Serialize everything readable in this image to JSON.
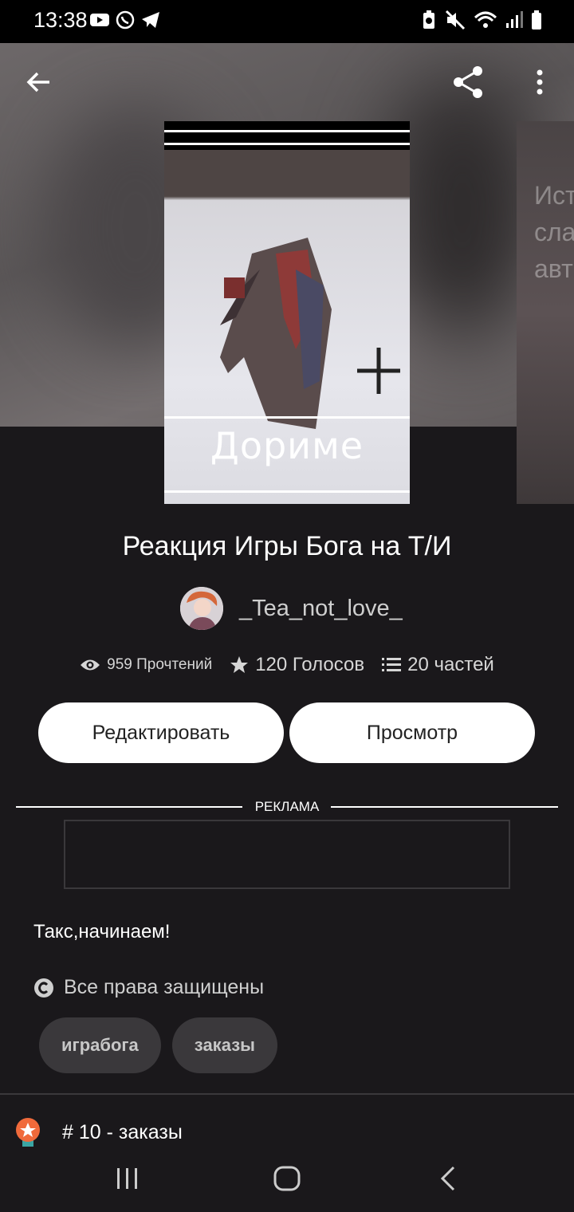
{
  "status_bar": {
    "time": "13:38"
  },
  "cover": {
    "title": "Дориме"
  },
  "next_cover": {
    "text": "Ист\nсла\nавт"
  },
  "story": {
    "title": "Реакция Игры Бога на Т/И",
    "author": "_Tea_not_love_"
  },
  "stats": {
    "reads": "959 Прочтений",
    "votes": "120 Голосов",
    "parts": "20 частей"
  },
  "actions": {
    "edit_label": "Редактировать",
    "view_label": "Просмотр"
  },
  "ad": {
    "label": "РЕКЛАМА"
  },
  "description": "Такс,начинаем!",
  "copyright": "Все права защищены",
  "tags": [
    "играбога",
    "заказы"
  ],
  "ranking": {
    "text": "# 10 - заказы"
  },
  "colors": {
    "background": "#1a181b",
    "button_bg": "#ffffff",
    "tag_bg": "#3a383b",
    "ranking_badge": "#f06a3b"
  },
  "icons": [
    "back-arrow-icon",
    "share-icon",
    "more-vert-icon",
    "eye-icon",
    "star-icon",
    "list-icon",
    "copyright-icon",
    "ranking-badge-icon"
  ]
}
